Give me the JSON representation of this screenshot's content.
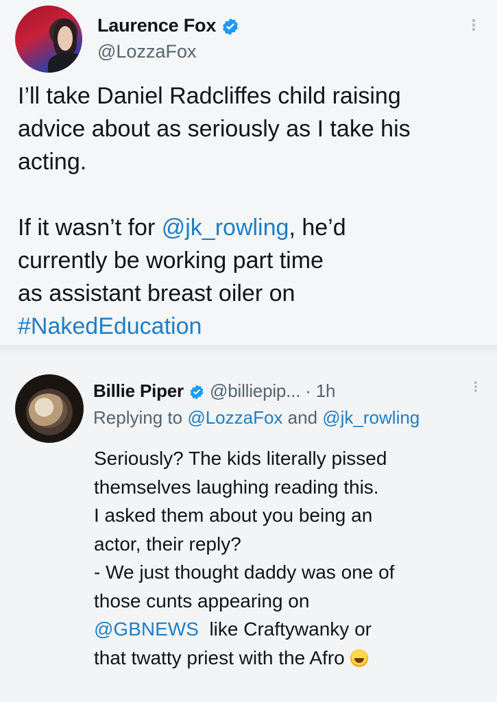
{
  "tweet": {
    "author_name": "Laurence Fox",
    "author_handle": "@LozzaFox",
    "more_icon": "more-vertical-icon",
    "paragraph1": [
      "I’ll take Daniel Radcliffes child raising",
      "advice about as seriously as I take his",
      "acting."
    ],
    "paragraph2_pre": "If it wasn’t for ",
    "paragraph2_mention": "@jk_rowling",
    "paragraph2_post": ", he’d",
    "paragraph2_lines": [
      "currently be working part time",
      "as assistant breast oiler on"
    ],
    "hashtag": "#NakedEducation"
  },
  "reply": {
    "author_name": "Billie Piper",
    "author_handle": "@billiepip...",
    "time": "· 1h",
    "replying_prefix": "Replying to ",
    "replying_to_1": "@LozzaFox",
    "replying_and": " and ",
    "replying_to_2": "@jk_rowling",
    "lines": [
      "Seriously? The kids literally pissed",
      "themselves laughing reading this.",
      "I asked them about you being an",
      "actor, their reply?",
      "- We just thought daddy was one of",
      "those cunts appearing on"
    ],
    "mention_line_mention": "@GBNEWS",
    "mention_line_rest": "  like Craftywanky or",
    "last_line": "that twatty priest with the Afro",
    "emoji": "grinning-sweat-emoji"
  },
  "colors": {
    "verified": "#1d9bf0",
    "link": "#1d7ec7",
    "secondary_text": "#536471"
  }
}
